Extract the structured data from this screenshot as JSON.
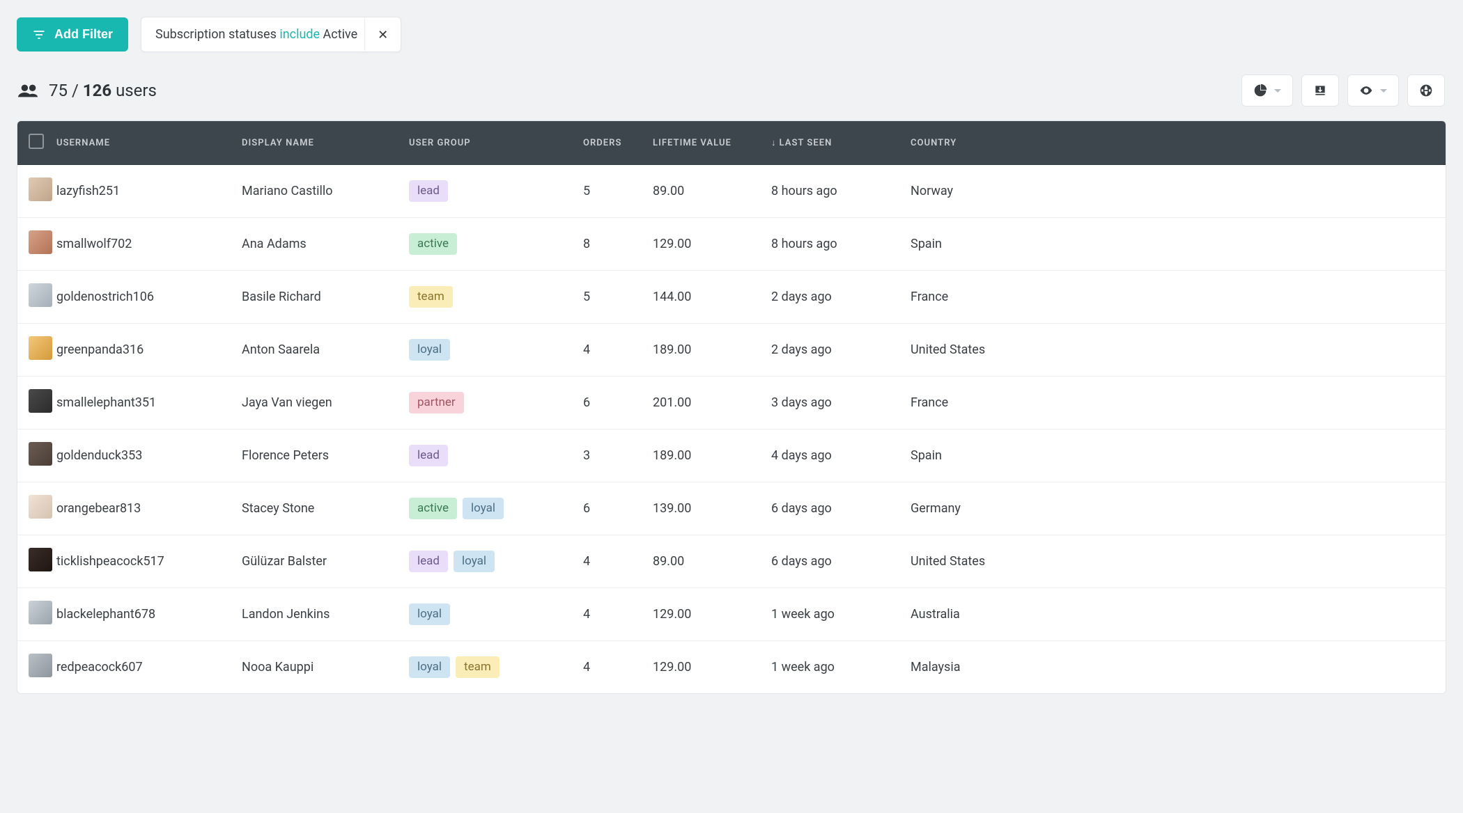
{
  "toolbar": {
    "add_filter_label": "Add Filter"
  },
  "active_filter": {
    "field": "Subscription statuses",
    "operator": "include",
    "value": "Active"
  },
  "summary": {
    "filtered_count": "75",
    "divider": "/",
    "total_count": "126",
    "suffix": "users"
  },
  "columns": {
    "username": "USERNAME",
    "display_name": "DISPLAY NAME",
    "user_group": "USER GROUP",
    "orders": "ORDERS",
    "lifetime_value": "LIFETIME VALUE",
    "last_seen": "LAST SEEN",
    "country": "COUNTRY",
    "sort_indicator": "↓"
  },
  "tag_labels": {
    "lead": "lead",
    "active": "active",
    "team": "team",
    "loyal": "loyal",
    "partner": "partner"
  },
  "rows": [
    {
      "username": "lazyfish251",
      "display_name": "Mariano Castillo",
      "groups": [
        "lead"
      ],
      "orders": "5",
      "ltv": "89.00",
      "last_seen": "8 hours ago",
      "country": "Norway",
      "avatar_bg": "linear-gradient(135deg,#e0c9b3,#bfa58a)"
    },
    {
      "username": "smallwolf702",
      "display_name": "Ana Adams",
      "groups": [
        "active"
      ],
      "orders": "8",
      "ltv": "129.00",
      "last_seen": "8 hours ago",
      "country": "Spain",
      "avatar_bg": "linear-gradient(135deg,#d6a18a,#b37355)"
    },
    {
      "username": "goldenostrich106",
      "display_name": "Basile Richard",
      "groups": [
        "team"
      ],
      "orders": "5",
      "ltv": "144.00",
      "last_seen": "2 days ago",
      "country": "France",
      "avatar_bg": "linear-gradient(135deg,#cfd6dc,#a5afb7)"
    },
    {
      "username": "greenpanda316",
      "display_name": "Anton Saarela",
      "groups": [
        "loyal"
      ],
      "orders": "4",
      "ltv": "189.00",
      "last_seen": "2 days ago",
      "country": "United States",
      "avatar_bg": "linear-gradient(135deg,#f3c77a,#d49a3a)"
    },
    {
      "username": "smallelephant351",
      "display_name": "Jaya Van viegen",
      "groups": [
        "partner"
      ],
      "orders": "6",
      "ltv": "201.00",
      "last_seen": "3 days ago",
      "country": "France",
      "avatar_bg": "linear-gradient(135deg,#4a4a4a,#2b2b2b)"
    },
    {
      "username": "goldenduck353",
      "display_name": "Florence Peters",
      "groups": [
        "lead"
      ],
      "orders": "3",
      "ltv": "189.00",
      "last_seen": "4 days ago",
      "country": "Spain",
      "avatar_bg": "linear-gradient(135deg,#6b5c52,#4a3e36)"
    },
    {
      "username": "orangebear813",
      "display_name": "Stacey Stone",
      "groups": [
        "active",
        "loyal"
      ],
      "orders": "6",
      "ltv": "139.00",
      "last_seen": "6 days ago",
      "country": "Germany",
      "avatar_bg": "linear-gradient(135deg,#f0e2d5,#d6c3b1)"
    },
    {
      "username": "ticklishpeacock517",
      "display_name": "Gülüzar Balster",
      "groups": [
        "lead",
        "loyal"
      ],
      "orders": "4",
      "ltv": "89.00",
      "last_seen": "6 days ago",
      "country": "United States",
      "avatar_bg": "linear-gradient(135deg,#3a2d28,#1e1512)"
    },
    {
      "username": "blackelephant678",
      "display_name": "Landon Jenkins",
      "groups": [
        "loyal"
      ],
      "orders": "4",
      "ltv": "129.00",
      "last_seen": "1 week ago",
      "country": "Australia",
      "avatar_bg": "linear-gradient(135deg,#cbd2d8,#9aa3ab)"
    },
    {
      "username": "redpeacock607",
      "display_name": "Nooa Kauppi",
      "groups": [
        "loyal",
        "team"
      ],
      "orders": "4",
      "ltv": "129.00",
      "last_seen": "1 week ago",
      "country": "Malaysia",
      "avatar_bg": "linear-gradient(135deg,#b9c0c6,#8e969d)"
    }
  ]
}
